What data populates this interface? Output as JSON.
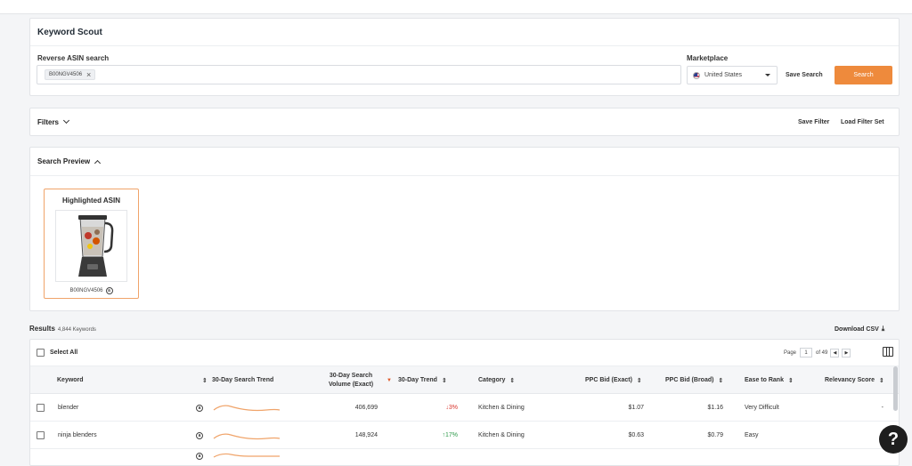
{
  "keyword_scout": {
    "title": "Keyword Scout",
    "reverse_label": "Reverse ASIN search",
    "asin_chip": "B00NGV4506",
    "marketplace_label": "Marketplace",
    "marketplace_value": "United States",
    "save_search": "Save Search",
    "search_button": "Search"
  },
  "filters": {
    "title": "Filters",
    "save_filter": "Save Filter",
    "load_filter_set": "Load Filter Set"
  },
  "preview": {
    "title": "Search Preview",
    "card_title": "Highlighted ASIN",
    "asin": "B00NGV4506"
  },
  "results": {
    "label": "Results",
    "count": "4,844 Keywords",
    "download": "Download CSV",
    "select_all": "Select All",
    "page_label": "Page",
    "page_current": "1",
    "page_total": "of 49"
  },
  "table": {
    "columns": {
      "keyword": "Keyword",
      "trend_chart": "30-Day Search Trend",
      "volume_line1": "30-Day Search",
      "volume_line2": "Volume (Exact)",
      "trend_pct": "30-Day Trend",
      "category": "Category",
      "ppc_exact": "PPC Bid (Exact)",
      "ppc_broad": "PPC Bid (Broad)",
      "ease": "Ease to Rank",
      "relevancy": "Relevancy Score"
    },
    "rows": [
      {
        "keyword": "blender",
        "volume": "406,699",
        "trend": "3%",
        "trend_dir": "down",
        "category": "Kitchen & Dining",
        "ppc_exact": "$1.07",
        "ppc_broad": "$1.16",
        "ease": "Very Difficult",
        "relevancy": "-"
      },
      {
        "keyword": "ninja blenders",
        "volume": "148,924",
        "trend": "17%",
        "trend_dir": "up",
        "category": "Kitchen & Dining",
        "ppc_exact": "$0.63",
        "ppc_broad": "$0.79",
        "ease": "Easy",
        "relevancy": ""
      }
    ]
  },
  "colors": {
    "accent": "#ee8a3c",
    "trend_up": "#2e9a4b",
    "trend_down": "#d9342b",
    "sparkline": "#f0a46a"
  },
  "help": {
    "label": "?"
  }
}
